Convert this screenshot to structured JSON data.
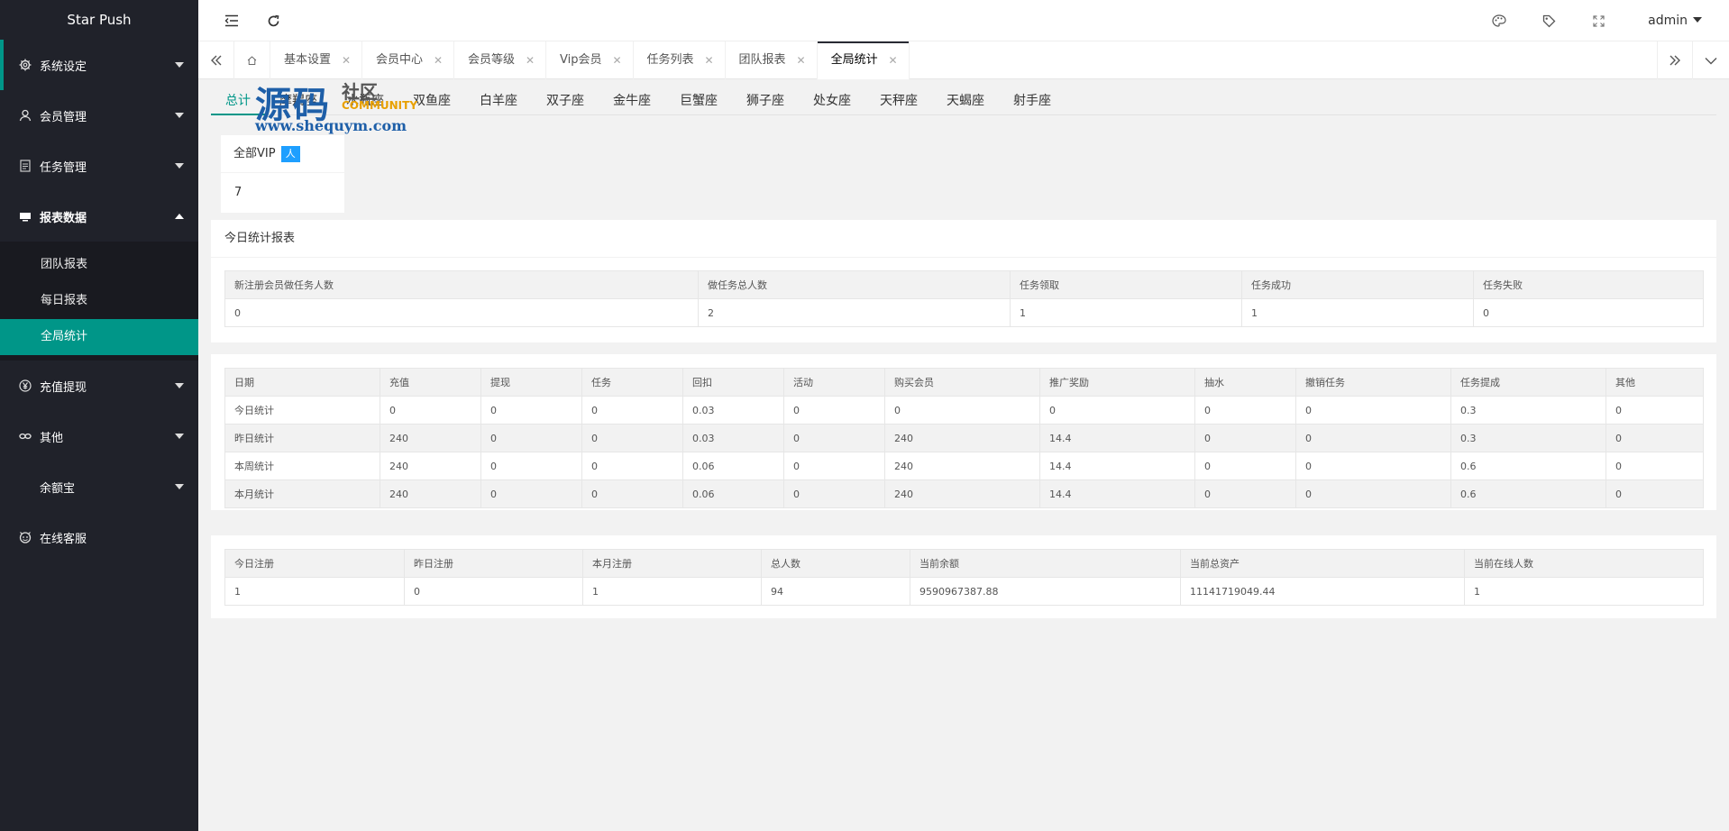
{
  "sidebar": {
    "logo": "Star Push",
    "menu": [
      {
        "label": "系统设定",
        "icon": "gear-icon"
      },
      {
        "label": "会员管理",
        "icon": "user-icon"
      },
      {
        "label": "任务管理",
        "icon": "document-icon"
      },
      {
        "label": "报表数据",
        "icon": "report-icon"
      }
    ],
    "submenu": [
      "团队报表",
      "每日报表",
      "全局统计"
    ],
    "menu2": [
      {
        "label": "充值提现",
        "icon": "yen-icon"
      },
      {
        "label": "其他",
        "icon": "link-icon"
      },
      {
        "label": "余额宝",
        "icon": ""
      },
      {
        "label": "在线客服",
        "icon": "support-icon"
      }
    ]
  },
  "header": {
    "user": "admin"
  },
  "tabs": [
    "基本设置",
    "会员中心",
    "会员等级",
    "Vip会员",
    "任务列表",
    "团队报表",
    "全局统计"
  ],
  "star_tabs": [
    "总计",
    "摩羯座",
    "水瓶座",
    "双鱼座",
    "白羊座",
    "双子座",
    "金牛座",
    "巨蟹座",
    "狮子座",
    "处女座",
    "天秤座",
    "天蝎座",
    "射手座"
  ],
  "vip_card": {
    "title": "全部VIP",
    "badge": "人",
    "value": "7"
  },
  "today_report": {
    "title": "今日统计报表",
    "headers": [
      "新注册会员做任务人数",
      "做任务总人数",
      "任务领取",
      "任务成功",
      "任务失败"
    ],
    "row": [
      "0",
      "2",
      "1",
      "1",
      "0"
    ]
  },
  "stats_table": {
    "headers": [
      "日期",
      "充值",
      "提现",
      "任务",
      "回扣",
      "活动",
      "购买会员",
      "推广奖励",
      "抽水",
      "撤销任务",
      "任务提成",
      "其他"
    ],
    "rows": [
      [
        "今日统计",
        "0",
        "0",
        "0",
        "0.03",
        "0",
        "0",
        "0",
        "0",
        "0",
        "0.3",
        "0"
      ],
      [
        "昨日统计",
        "240",
        "0",
        "0",
        "0.03",
        "0",
        "240",
        "14.4",
        "0",
        "0",
        "0.3",
        "0"
      ],
      [
        "本周统计",
        "240",
        "0",
        "0",
        "0.06",
        "0",
        "240",
        "14.4",
        "0",
        "0",
        "0.6",
        "0"
      ],
      [
        "本月统计",
        "240",
        "0",
        "0",
        "0.06",
        "0",
        "240",
        "14.4",
        "0",
        "0",
        "0.6",
        "0"
      ]
    ]
  },
  "reg_table": {
    "headers": [
      "今日注册",
      "昨日注册",
      "本月注册",
      "总人数",
      "当前余额",
      "当前总资产",
      "当前在线人数"
    ],
    "row": [
      "1",
      "0",
      "1",
      "94",
      "9590967387.88",
      "11141719049.44",
      "1"
    ]
  },
  "watermark": {
    "big": "源码",
    "small": "社区",
    "en": "COMMUNITY",
    "url": "www.shequym.com"
  },
  "colors": {
    "sidebar": "#20222a",
    "accent": "#009688",
    "badge": "#1e9fff"
  }
}
